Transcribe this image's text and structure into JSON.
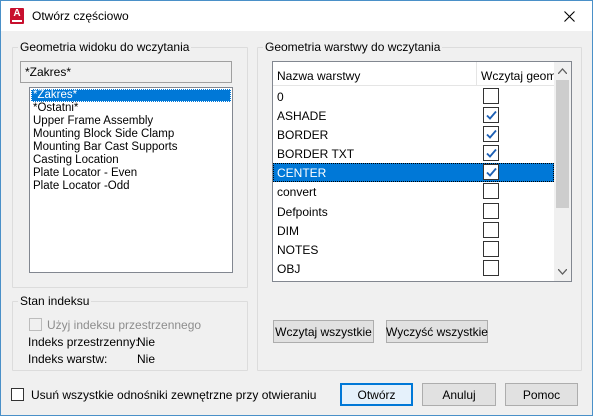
{
  "window": {
    "title": "Otwórz częściowo"
  },
  "view_group": {
    "legend": "Geometria widoku do wczytania",
    "combo_value": "*Zakres*",
    "items": [
      {
        "label": "*Zakres*",
        "selected": true
      },
      {
        "label": "*Ostatni*",
        "selected": false
      },
      {
        "label": "Upper Frame Assembly",
        "selected": false
      },
      {
        "label": "Mounting Block Side Clamp",
        "selected": false
      },
      {
        "label": "Mounting Bar Cast Supports",
        "selected": false
      },
      {
        "label": "Casting Location",
        "selected": false
      },
      {
        "label": "Plate Locator - Even",
        "selected": false
      },
      {
        "label": "Plate Locator -Odd",
        "selected": false
      }
    ]
  },
  "index_group": {
    "legend": "Stan indeksu",
    "use_spatial_index_label": "Użyj indeksu przestrzennego",
    "spatial_index_label": "Indeks przestrzenny:",
    "spatial_index_value": "Nie",
    "layer_index_label": "Indeks warstw:",
    "layer_index_value": "Nie"
  },
  "layer_group": {
    "legend": "Geometria warstwy do wczytania",
    "col_name": "Nazwa warstwy",
    "col_load": "Wczytaj geometrię",
    "rows": [
      {
        "name": "0",
        "checked": false,
        "selected": false
      },
      {
        "name": "ASHADE",
        "checked": true,
        "selected": false
      },
      {
        "name": "BORDER",
        "checked": true,
        "selected": false
      },
      {
        "name": "BORDER TXT",
        "checked": true,
        "selected": false
      },
      {
        "name": "CENTER",
        "checked": true,
        "selected": true
      },
      {
        "name": "convert",
        "checked": false,
        "selected": false
      },
      {
        "name": "Defpoints",
        "checked": false,
        "selected": false
      },
      {
        "name": "DIM",
        "checked": false,
        "selected": false
      },
      {
        "name": "NOTES",
        "checked": false,
        "selected": false
      },
      {
        "name": "OBJ",
        "checked": false,
        "selected": false
      }
    ],
    "load_all_label": "Wczytaj wszystkie",
    "clear_all_label": "Wyczyść wszystkie"
  },
  "footer": {
    "unload_xrefs_label": "Usuń wszystkie odnośniki zewnętrzne przy otwieraniu",
    "open_label": "Otwórz",
    "cancel_label": "Anuluj",
    "help_label": "Pomoc"
  },
  "colors": {
    "selection": "#0078d7",
    "check": "#1c5fb4",
    "app_icon": "#c8102e"
  }
}
